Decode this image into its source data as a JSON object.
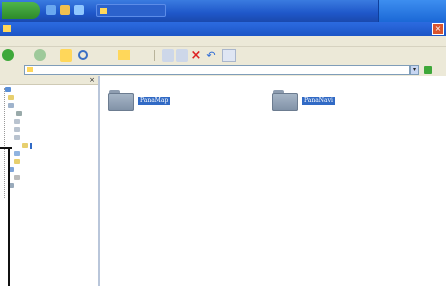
{
  "colors": {
    "taskbar_blue": "#1f57c9",
    "selection_blue": "#316ac5",
    "chrome_beige": "#ece9d8",
    "folder_gray": "#8e9db0",
    "close_red": "#d9552f",
    "start_green": "#2d8a2a"
  },
  "folders": [
    {
      "name": "PanaMap",
      "icon": "folder-icon"
    },
    {
      "name": "PanaNavi",
      "icon": "folder-icon"
    }
  ]
}
